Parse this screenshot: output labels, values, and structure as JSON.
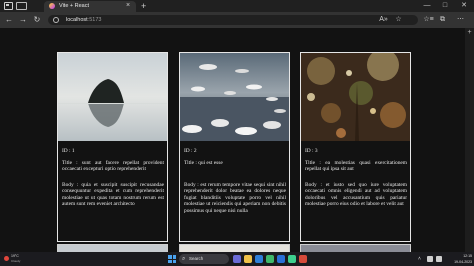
{
  "browser": {
    "tab_title": "Vite + React",
    "tab_close": "×",
    "new_tab": "+",
    "url_host": "localhost",
    "url_port": ":5173",
    "window_controls": {
      "minimize": "—",
      "maximize": "□",
      "close": "✕"
    },
    "nav": {
      "back": "←",
      "forward": "→",
      "reload": "↻"
    },
    "toolbar_icons": {
      "read_aloud": "A»",
      "favorite": "☆",
      "favorites": "☆≡",
      "collections": "⧉",
      "more": "⋯"
    }
  },
  "cards": [
    {
      "id": "ID : 1",
      "title": "Title : sunt aut facere repellat provident occaecati excepturi optio reprehenderit",
      "body": "Body : quia et suscipit suscipit recusandae consequuntur expedita et cum reprehenderit molestiae ut ut quas totam nostrum rerum est autem sunt rem eveniet architecto"
    },
    {
      "id": "ID : 2",
      "title": "Title : qui est esse",
      "body": "Body : est rerum tempore vitae sequi sint nihil reprehenderit dolor beatae ea dolores neque fugiat blanditiis voluptate porro vel nihil molestiae ut reiciendis qui aperiam non debitis possimus qui neque nisi nulla"
    },
    {
      "id": "ID : 3",
      "title": "Title : ea molestias quasi exercitationem repellat qui ipsa sit aut",
      "body": "Body : et iusto sed quo iure voluptatem occaecati omnis eligendi aut ad voluptatem doloribus vel accusantium quis pariatur molestiae porro eius odio et labore et velit aut"
    }
  ],
  "taskbar": {
    "weather_temp": "19°C",
    "weather_desc": "Cloudy",
    "search_label": "Search",
    "search_icon": "⌕",
    "tray_up": "˄",
    "clock_time": "12:15",
    "clock_date": "19-04-2023"
  }
}
